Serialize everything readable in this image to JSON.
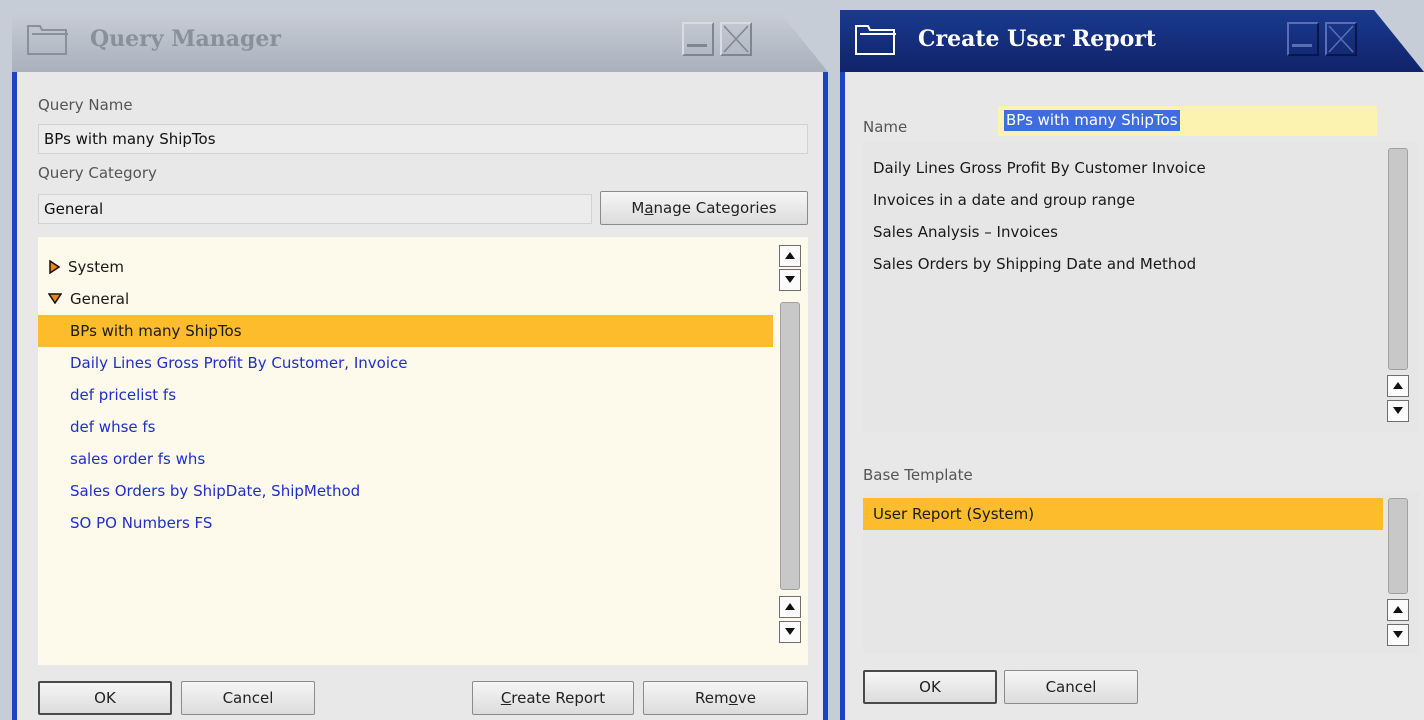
{
  "query_manager": {
    "title": "Query Manager",
    "query_name_label": "Query Name",
    "query_name_value": "BPs with many ShipTos",
    "query_category_label": "Query Category",
    "query_category_value": "General",
    "manage_categories_pre": "M",
    "manage_categories_ul": "a",
    "manage_categories_post": "nage Categories",
    "tree": {
      "system": "System",
      "general": "General",
      "queries": [
        "BPs with many ShipTos",
        "Daily Lines Gross Profit By Customer, Invoice",
        "def pricelist fs",
        "def whse fs",
        "sales order fs whs",
        "Sales Orders by ShipDate, ShipMethod",
        "SO PO Numbers FS"
      ]
    },
    "ok_label": "OK",
    "cancel_label": "Cancel",
    "create_report_ul": "C",
    "create_report_post": "reate Report",
    "remove_pre": "Rem",
    "remove_ul": "o",
    "remove_post": "ve"
  },
  "create_user_report": {
    "title": "Create User Report",
    "name_label": "Name",
    "name_value": "BPs with many ShipTos",
    "reports": [
      "Daily Lines Gross Profit By Customer Invoice",
      "Invoices in a date and group range",
      "Sales Analysis – Invoices",
      "Sales Orders by Shipping Date and Method"
    ],
    "base_template_label": "Base Template",
    "templates": [
      "User Report (System)"
    ],
    "ok_label": "OK",
    "cancel_label": "Cancel"
  },
  "colors": {
    "selection": "#fcbc2c",
    "query_link": "#1f2ec4",
    "active_title": "#13266b",
    "inactive_title": "#a9b1bd",
    "window_edge": "#1b44c2",
    "name_field_bg": "#fdf3b0",
    "name_highlight_bg": "#3f6de0"
  },
  "icons": [
    "window-icon",
    "minimize-icon",
    "close-icon",
    "expand-arrow-icon",
    "collapse-arrow-icon",
    "scroll-up-icon",
    "scroll-down-icon"
  ]
}
